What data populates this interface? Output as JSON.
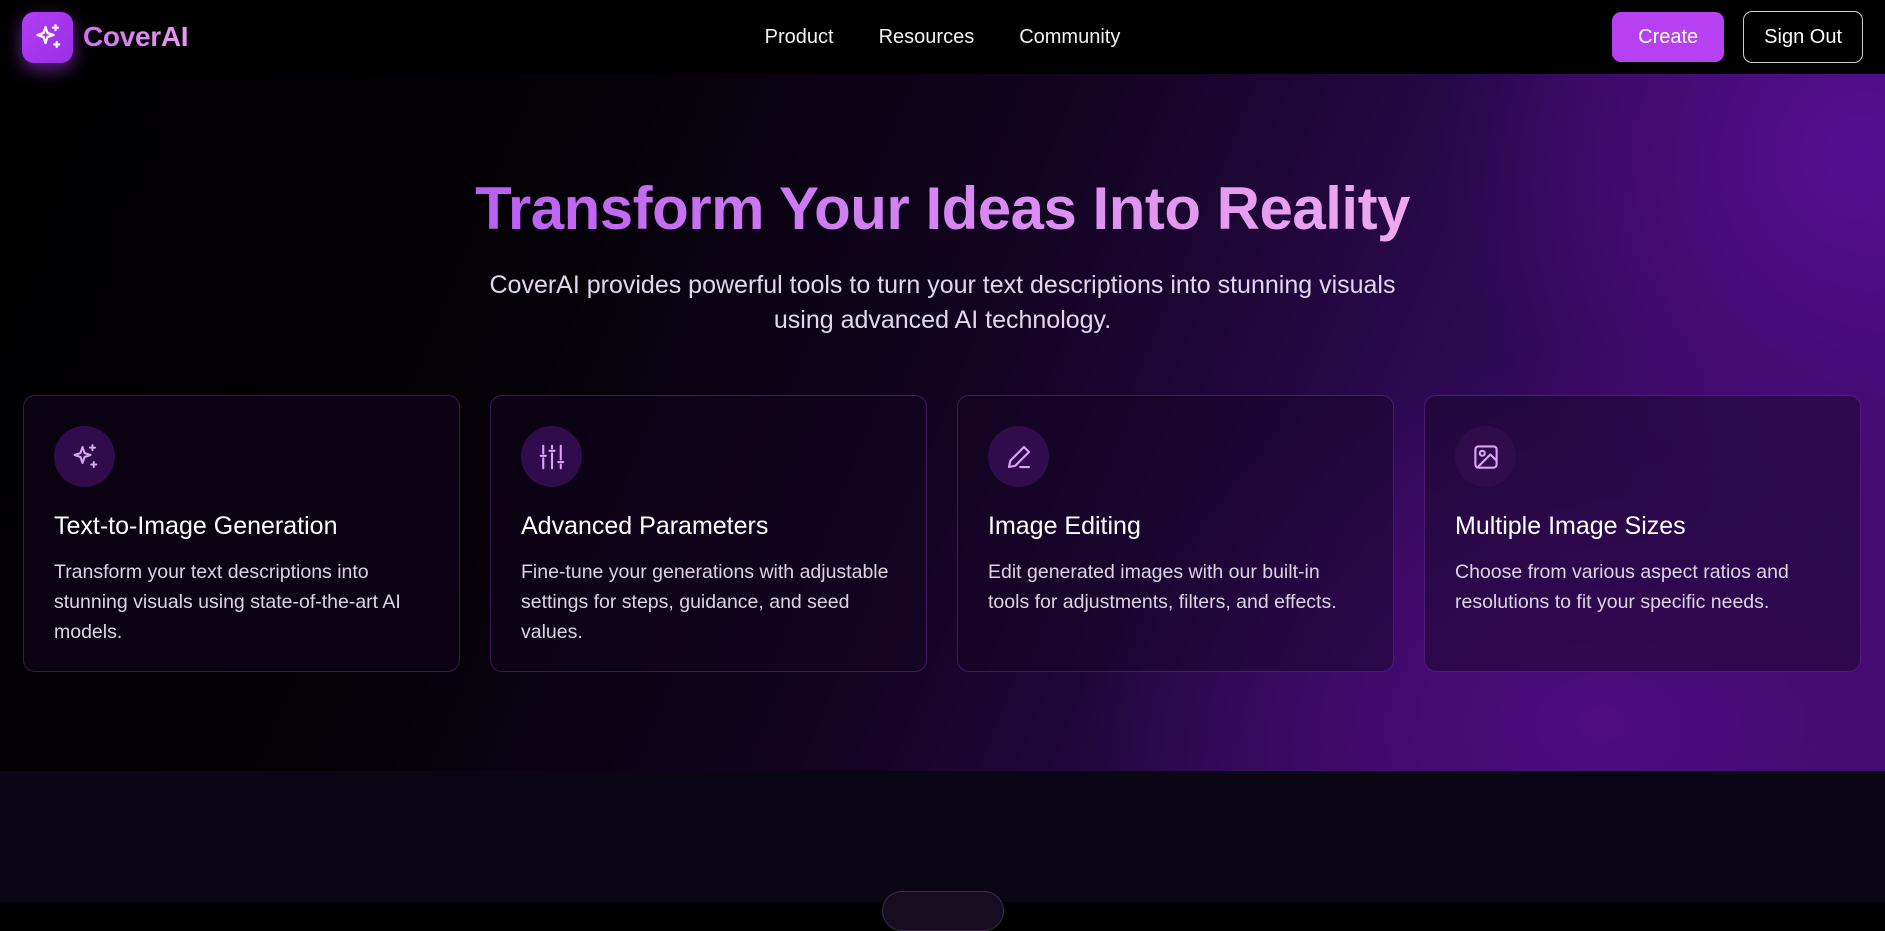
{
  "brand": {
    "name": "CoverAI",
    "logo_icon": "sparkles-icon"
  },
  "nav": {
    "links": [
      "Product",
      "Resources",
      "Community"
    ],
    "create_label": "Create",
    "signout_label": "Sign Out"
  },
  "hero": {
    "title": "Transform Your Ideas Into Reality",
    "subtitle": "CoverAI provides powerful tools to turn your text descriptions into stunning visuals using advanced AI technology."
  },
  "features": [
    {
      "icon": "sparkles-icon",
      "title": "Text-to-Image Generation",
      "text": "Transform your text descriptions into stunning visuals using state-of-the-art AI models."
    },
    {
      "icon": "sliders-icon",
      "title": "Advanced Parameters",
      "text": "Fine-tune your generations with adjustable settings for steps, guidance, and seed values."
    },
    {
      "icon": "pencil-icon",
      "title": "Image Editing",
      "text": "Edit generated images with our built-in tools for adjustments, filters, and effects."
    },
    {
      "icon": "image-icon",
      "title": "Multiple Image Sizes",
      "text": "Choose from various aspect ratios and resolutions to fit your specific needs."
    }
  ],
  "colors": {
    "accent": "#b740f3",
    "background": "#000000",
    "icon_stroke": "#d8a6f5"
  }
}
